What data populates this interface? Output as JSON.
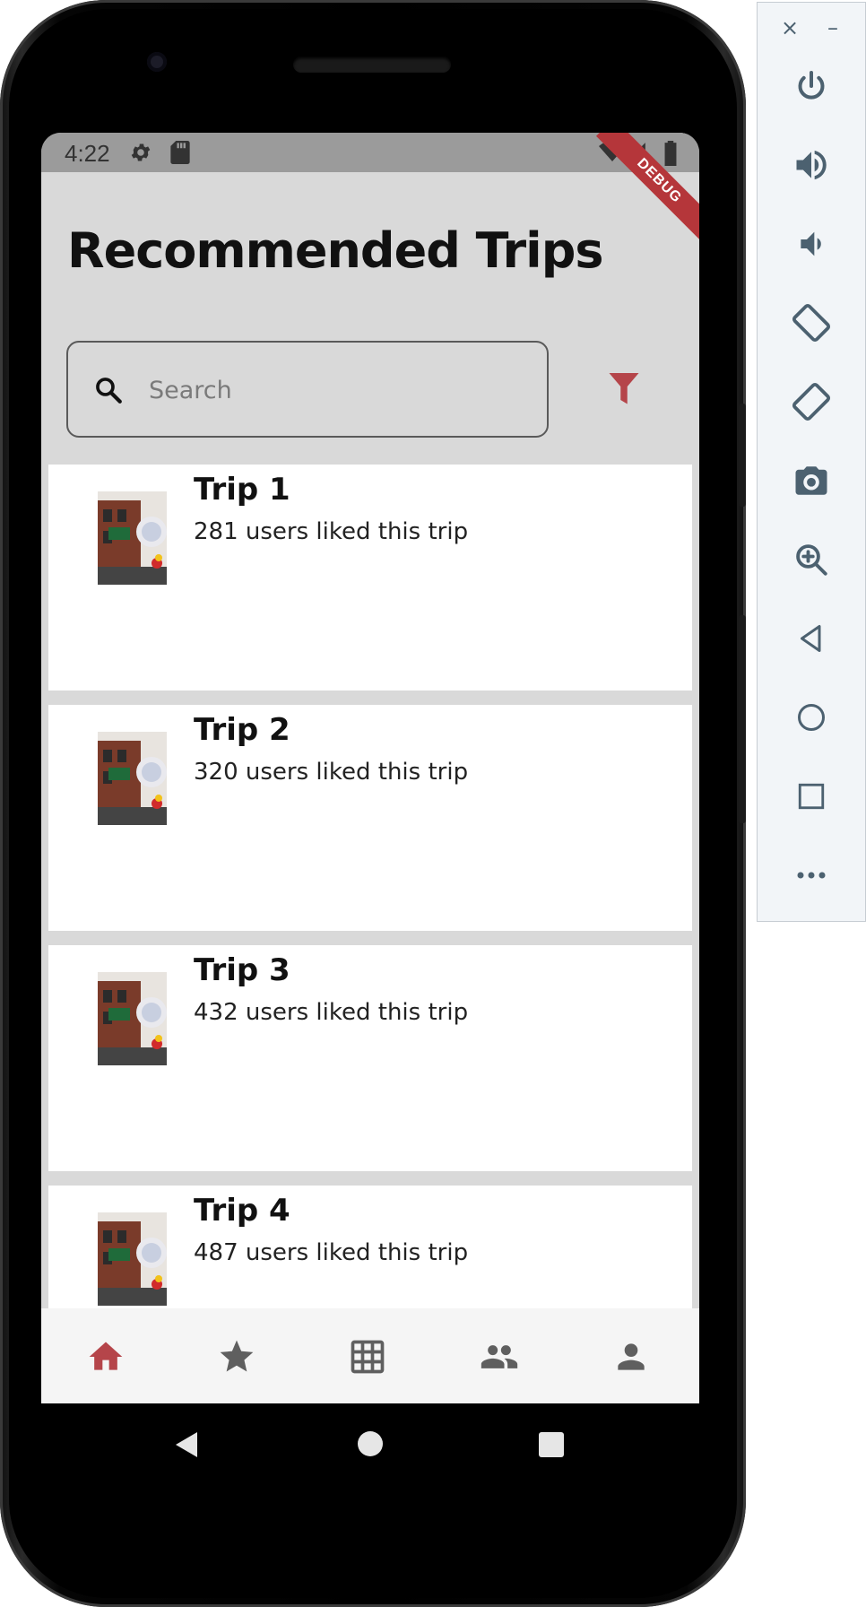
{
  "status_bar": {
    "time": "4:22",
    "debug_label": "DEBUG"
  },
  "header": {
    "title": "Recommended Trips"
  },
  "search": {
    "placeholder": "Search",
    "value": ""
  },
  "colors": {
    "accent": "#b5454a",
    "background": "#d9d9d9",
    "card": "#ffffff",
    "status_bar": "#9b9b9b"
  },
  "trips": [
    {
      "title": "Trip 1",
      "likes": "281 users liked this trip"
    },
    {
      "title": "Trip 2",
      "likes": "320 users liked this trip"
    },
    {
      "title": "Trip 3",
      "likes": "432 users liked this trip"
    },
    {
      "title": "Trip 4",
      "likes": "487 users liked this trip"
    }
  ],
  "bottom_nav": [
    {
      "icon": "home-icon",
      "active": true
    },
    {
      "icon": "star-icon",
      "active": false
    },
    {
      "icon": "grid-icon",
      "active": false
    },
    {
      "icon": "people-icon",
      "active": false
    },
    {
      "icon": "person-icon",
      "active": false
    }
  ],
  "emulator_toolbar": {
    "close": "×",
    "minimize": "–",
    "buttons": [
      "power-icon",
      "volume-up-icon",
      "volume-down-icon",
      "rotate-left-icon",
      "rotate-right-icon",
      "camera-icon",
      "zoom-icon",
      "back-icon",
      "home-icon",
      "overview-icon",
      "more-icon"
    ]
  }
}
